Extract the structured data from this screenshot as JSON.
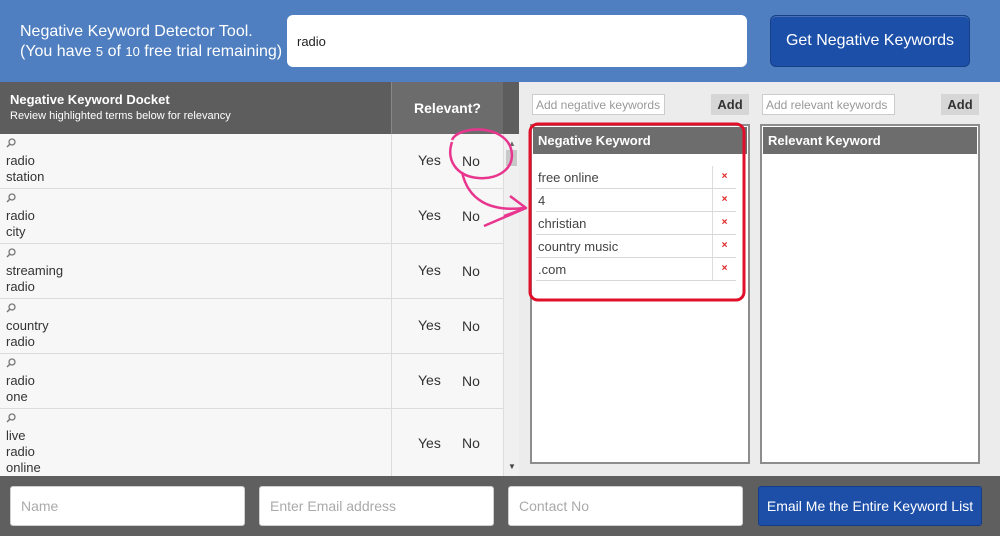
{
  "header": {
    "title_line1": "Negative Keyword Detector Tool.",
    "title_line2_a": "(You have ",
    "trial_used": "5",
    "title_line2_b": " of ",
    "trial_total": "10",
    "title_line2_c": " free trial remaining)",
    "search_value": "radio",
    "get_button": "Get Negative Keywords"
  },
  "docket": {
    "title": "Negative Keyword Docket",
    "subtitle": "Review highlighted terms below for relevancy",
    "relevant_header": "Relevant?",
    "yes_label": "Yes",
    "no_label": "No",
    "rows": [
      {
        "keyword": "radio\nstation"
      },
      {
        "keyword": "radio\ncity"
      },
      {
        "keyword": "streaming\nradio"
      },
      {
        "keyword": "country\nradio"
      },
      {
        "keyword": "radio\none"
      },
      {
        "keyword": "live\nradio\nonline"
      }
    ]
  },
  "negative_panel": {
    "add_placeholder": "Add negative keywords",
    "add_button": "Add",
    "header": "Negative Keyword",
    "items": [
      "free online",
      "4",
      "christian",
      "country music",
      ".com"
    ],
    "remove_glyph": "×"
  },
  "relevant_panel": {
    "add_placeholder": "Add relevant keywords",
    "add_button": "Add",
    "header": "Relevant Keyword"
  },
  "footer": {
    "name_placeholder": "Name",
    "email_placeholder": "Enter Email address",
    "contact_placeholder": "Contact No",
    "email_button": "Email Me the Entire Keyword List"
  },
  "colors": {
    "header_bg": "#4f7fc0",
    "button_blue": "#1c4fa8",
    "annotation_red": "#e0102a",
    "annotation_pink": "#e8368f"
  }
}
